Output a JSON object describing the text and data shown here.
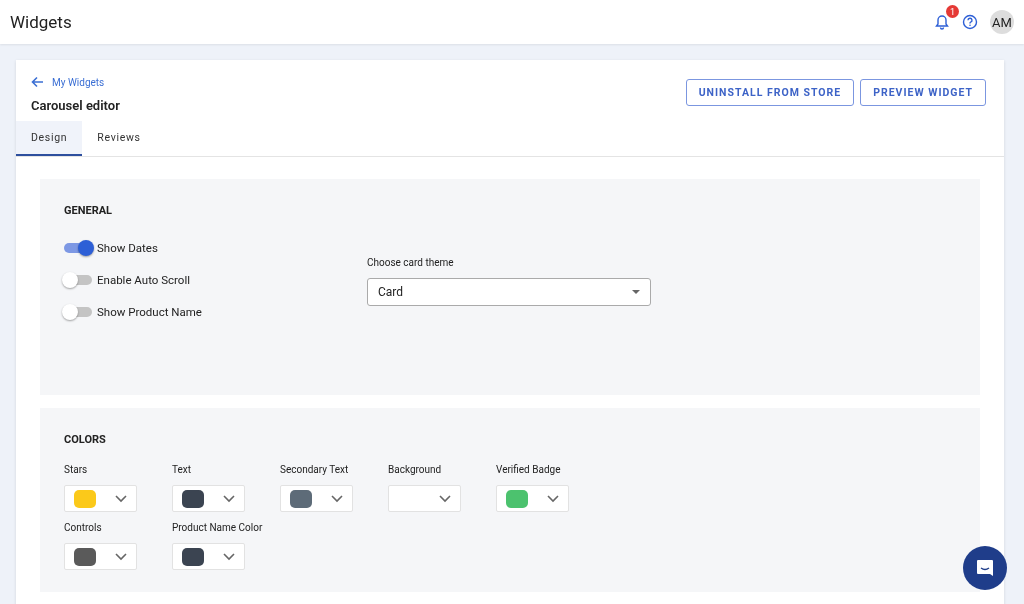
{
  "topbar": {
    "title": "Widgets",
    "notification_count": "1",
    "avatar": "AM"
  },
  "header": {
    "back_link": "My Widgets",
    "title": "Carousel editor",
    "buttons": [
      "UNINSTALL FROM STORE",
      "PREVIEW WIDGET"
    ]
  },
  "tabs": [
    {
      "label": "Design",
      "selected": true
    },
    {
      "label": "Reviews",
      "selected": false
    }
  ],
  "general": {
    "title": "GENERAL",
    "toggles": [
      {
        "label": "Show Dates",
        "on": true
      },
      {
        "label": "Enable Auto Scroll",
        "on": false
      },
      {
        "label": "Show Product Name",
        "on": false
      }
    ],
    "theme": {
      "label": "Choose card theme",
      "value": "Card"
    }
  },
  "colors": {
    "title": "COLORS",
    "pickers": [
      {
        "label": "Stars",
        "color": "#fbc91a"
      },
      {
        "label": "Text",
        "color": "#3b4451"
      },
      {
        "label": "Secondary Text",
        "color": "#5d6b78"
      },
      {
        "label": "Background"
      },
      {
        "label": "Verified Badge",
        "color": "#4cc26e"
      },
      {
        "label": "Controls",
        "color": "#5a5a5a"
      },
      {
        "label": "Product Name Color",
        "color": "#3b4451"
      }
    ]
  }
}
